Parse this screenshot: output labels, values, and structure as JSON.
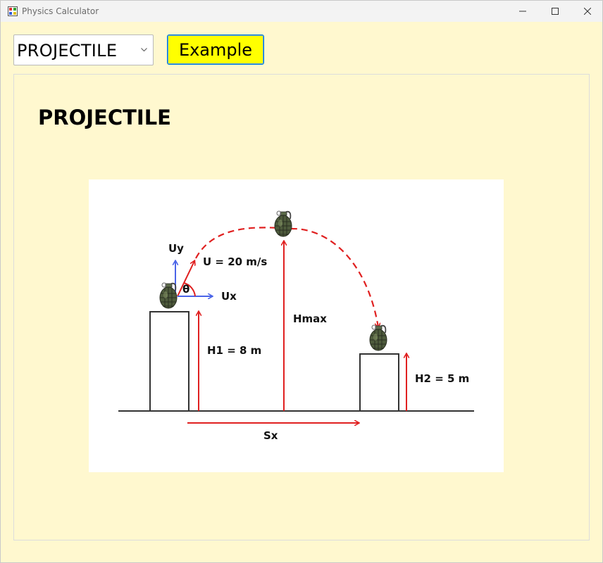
{
  "window": {
    "title": "Physics Calculator"
  },
  "toolbar": {
    "topic_select_value": "PROJECTILE",
    "example_button_label": "Example"
  },
  "panel": {
    "heading": "PROJECTILE"
  },
  "diagram": {
    "labels": {
      "uy": "Uy",
      "ux": "Ux",
      "theta": "θ",
      "velocity": "U = 20 m/s",
      "hmax": "Hmax",
      "h1": "H1 = 8 m",
      "h2": "H2 = 5 m",
      "sx": "Sx"
    }
  },
  "colors": {
    "background": "#fff8cf",
    "example_button": "#ffff00",
    "trajectory": "#e02020",
    "component_arrows": "#4a64e8"
  }
}
